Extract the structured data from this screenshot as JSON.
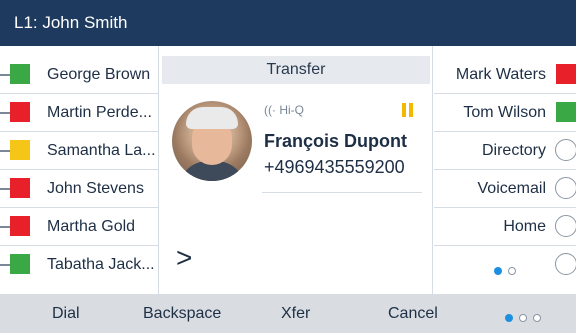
{
  "title": "L1: John Smith",
  "left_keys": [
    {
      "label": "George Brown",
      "status": "green"
    },
    {
      "label": "Martin Perde...",
      "status": "red"
    },
    {
      "label": "Samantha La...",
      "status": "yellow"
    },
    {
      "label": "John Stevens",
      "status": "red"
    },
    {
      "label": "Martha Gold",
      "status": "red"
    },
    {
      "label": "Tabatha Jack...",
      "status": "green"
    }
  ],
  "right_keys": [
    {
      "label": "Mark Waters",
      "status": "red"
    },
    {
      "label": "Tom Wilson",
      "status": "green"
    },
    {
      "label": "Directory",
      "status": "none"
    },
    {
      "label": "Voicemail",
      "status": "none"
    },
    {
      "label": "Home",
      "status": "none"
    },
    {
      "label": "",
      "status": "none"
    }
  ],
  "call": {
    "header": "Transfer",
    "hiq_label": "Hi-Q",
    "name": "François Dupont",
    "number": "+4969435559200",
    "state_icon": "pause-icon",
    "prompt": ">"
  },
  "softkeys": [
    "Dial",
    "Backspace",
    "Xfer",
    "Cancel"
  ],
  "colors": {
    "titlebar": "#1f3a5f",
    "red": "#e8202a",
    "green": "#3aa845",
    "yellow": "#f5c518",
    "accent": "#1d8fe0"
  }
}
